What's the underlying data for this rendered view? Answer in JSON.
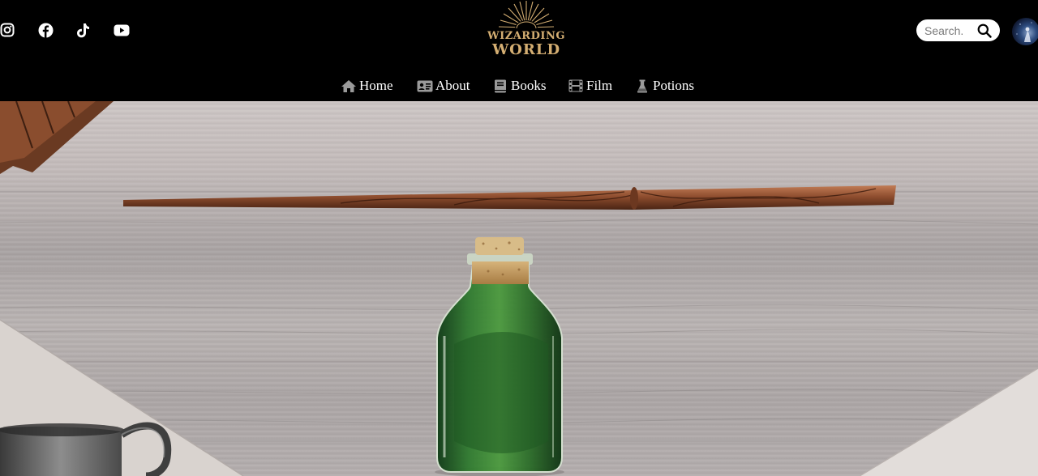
{
  "header": {
    "social": [
      {
        "icon": "instagram-icon"
      },
      {
        "icon": "facebook-icon"
      },
      {
        "icon": "tiktok-icon"
      },
      {
        "icon": "youtube-icon"
      }
    ],
    "logo": {
      "line1": "WIZARDING",
      "line2": "WORLD"
    },
    "search": {
      "placeholder": "Search.",
      "icon": "search-icon"
    },
    "avatar": {
      "icon": "user-avatar"
    }
  },
  "nav": {
    "items": [
      {
        "label": "Home",
        "icon": "home-icon"
      },
      {
        "label": "About",
        "icon": "id-card-icon"
      },
      {
        "label": "Books",
        "icon": "book-icon"
      },
      {
        "label": "Film",
        "icon": "film-icon"
      },
      {
        "label": "Potions",
        "icon": "flask-icon"
      }
    ]
  },
  "colors": {
    "header_bg": "#000000",
    "logo_gold": "#d4ae72",
    "nav_text": "#ffffff",
    "nav_icon": "#9a9a9a"
  }
}
